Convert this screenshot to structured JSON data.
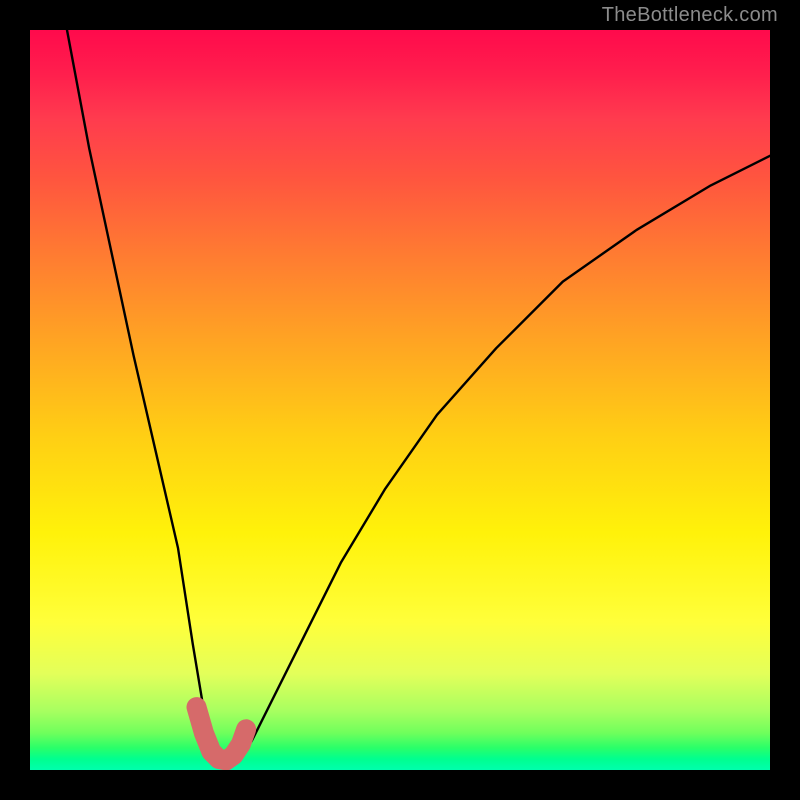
{
  "watermark": "TheBottleneck.com",
  "chart_data": {
    "type": "line",
    "title": "",
    "xlabel": "",
    "ylabel": "",
    "xlim": [
      0,
      100
    ],
    "ylim": [
      0,
      100
    ],
    "grid": false,
    "legend": false,
    "series": [
      {
        "name": "bottleneck-curve",
        "x": [
          5,
          8,
          11,
          14,
          17,
          20,
          22,
          23.5,
          25,
          26.5,
          28,
          30,
          33,
          37,
          42,
          48,
          55,
          63,
          72,
          82,
          92,
          100
        ],
        "y": [
          100,
          84,
          70,
          56,
          43,
          30,
          17,
          8,
          2,
          1,
          1,
          4,
          10,
          18,
          28,
          38,
          48,
          57,
          66,
          73,
          79,
          83
        ]
      },
      {
        "name": "valley-highlight",
        "x": [
          22.5,
          23.5,
          24.5,
          25.5,
          26.5,
          27.5,
          28.5,
          29.2
        ],
        "y": [
          8.5,
          5.0,
          2.5,
          1.5,
          1.3,
          2.0,
          3.5,
          5.5
        ]
      }
    ],
    "colors": {
      "curve": "#000000",
      "highlight": "#d66a6a",
      "gradient_top": "#ff0a4c",
      "gradient_mid": "#ffe000",
      "gradient_bottom": "#00ff9f",
      "frame": "#000000"
    }
  }
}
